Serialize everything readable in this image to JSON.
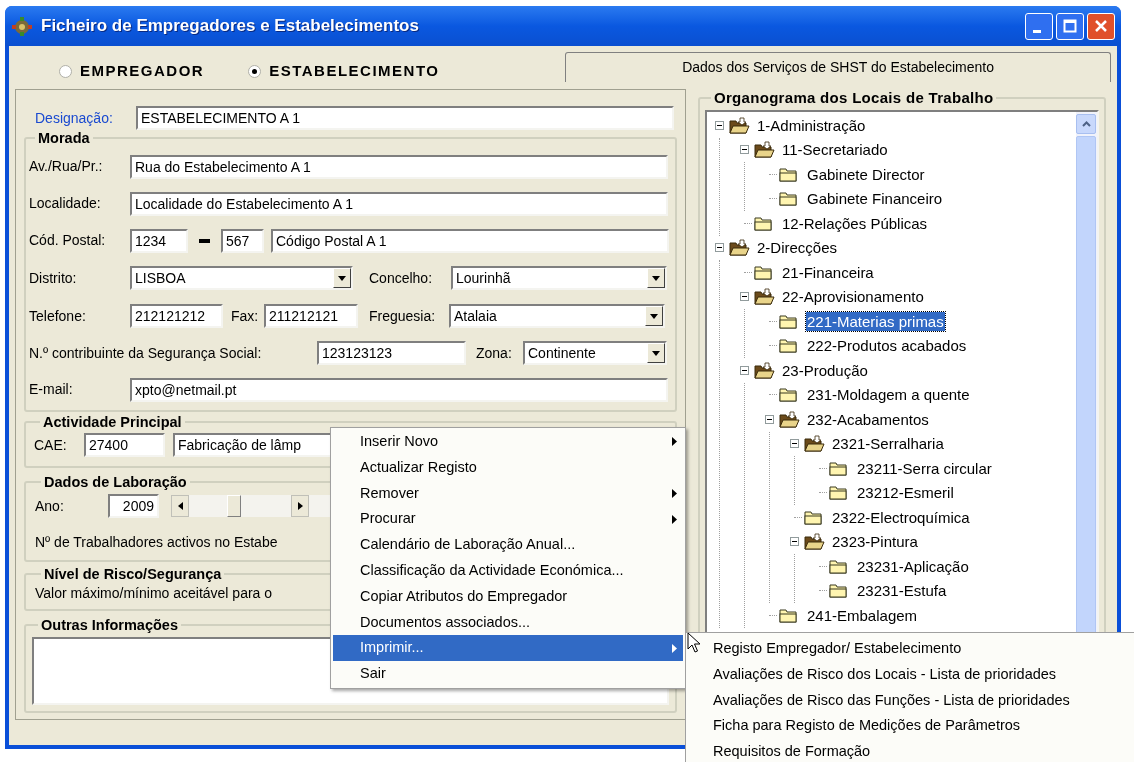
{
  "window": {
    "title": "Ficheiro de Empregadores e Estabelecimentos"
  },
  "entity_type": [
    {
      "label": "EMPREGADOR",
      "selected": false
    },
    {
      "label": "ESTABELECIMENTO",
      "selected": true
    }
  ],
  "tab": {
    "label": "Dados dos Serviços de SHST do Estabelecimento"
  },
  "designation": {
    "label": "Designação:",
    "value": "ESTABELECIMENTO A 1"
  },
  "address": {
    "title": "Morada",
    "street": {
      "label": "Av./Rua/Pr.:",
      "value": "Rua do Estabelecimento A 1"
    },
    "locality": {
      "label": "Localidade:",
      "value": "Localidade do Estabelecimento A 1"
    },
    "postal_code": {
      "label": "Cód. Postal:",
      "part_1": "1234",
      "part_2": "567",
      "description": "Código Postal A 1"
    },
    "district": {
      "label": "Distrito:",
      "value": "LISBOA"
    },
    "municipality": {
      "label": "Concelho:",
      "value": "Lourinhã"
    },
    "phone": {
      "label": "Telefone:",
      "value": "212121212"
    },
    "fax": {
      "label": "Fax:",
      "value": "211212121"
    },
    "parish": {
      "label": "Freguesia:",
      "value": "Atalaia"
    },
    "social_security": {
      "label": "N.º contribuinte da Segurança Social:",
      "value": "123123123"
    },
    "zone": {
      "label": "Zona:",
      "value": "Continente"
    },
    "email": {
      "label": "E-mail:",
      "value": "xpto@netmail.pt"
    }
  },
  "main_activity": {
    "title": "Actividade Principal",
    "cae_label": "CAE:",
    "cae_code": "27400",
    "cae_description": "Fabricação de lâmp"
  },
  "labour_data": {
    "title": "Dados de Laboração",
    "year_label": "Ano:",
    "year": "2009",
    "workers_text": "Nº de Trabalhadores activos no Estabe"
  },
  "risk_level": {
    "title": "Nível de Risco/Segurança",
    "text": "Valor máximo/mínimo aceitável para o"
  },
  "other_info": {
    "title": "Outras Informações"
  },
  "org_chart": {
    "title": "Organograma dos Locais de Trabalho",
    "tree": [
      {
        "label": "1-Administração",
        "expanded": true,
        "selected": false,
        "children": [
          {
            "label": "11-Secretariado",
            "expanded": true,
            "selected": false,
            "children": [
              {
                "label": "Gabinete Director",
                "expanded": false,
                "selected": false
              },
              {
                "label": "Gabinete Financeiro",
                "expanded": false,
                "selected": false
              }
            ]
          },
          {
            "label": "12-Relações Públicas",
            "expanded": false,
            "selected": false
          }
        ]
      },
      {
        "label": "2-Direcções",
        "expanded": true,
        "selected": false,
        "children": [
          {
            "label": "21-Financeira",
            "expanded": false,
            "selected": false
          },
          {
            "label": "22-Aprovisionamento",
            "expanded": true,
            "selected": false,
            "children": [
              {
                "label": "221-Materias primas",
                "expanded": false,
                "selected": true
              },
              {
                "label": "222-Produtos acabados",
                "expanded": false,
                "selected": false
              }
            ]
          },
          {
            "label": "23-Produção",
            "expanded": true,
            "selected": false,
            "children": [
              {
                "label": "231-Moldagem a quente",
                "expanded": false,
                "selected": false
              },
              {
                "label": "232-Acabamentos",
                "expanded": true,
                "selected": false,
                "children": [
                  {
                    "label": "2321-Serralharia",
                    "expanded": true,
                    "selected": false,
                    "children": [
                      {
                        "label": "23211-Serra circular",
                        "expanded": false,
                        "selected": false
                      },
                      {
                        "label": "23212-Esmeril",
                        "expanded": false,
                        "selected": false
                      }
                    ]
                  },
                  {
                    "label": "2322-Electroquímica",
                    "expanded": false,
                    "selected": false
                  },
                  {
                    "label": "2323-Pintura",
                    "expanded": true,
                    "selected": false,
                    "children": [
                      {
                        "label": "23231-Aplicação",
                        "expanded": false,
                        "selected": false
                      },
                      {
                        "label": "23231-Estufa",
                        "expanded": false,
                        "selected": false
                      }
                    ]
                  }
                ]
              },
              {
                "label": "241-Embalagem",
                "expanded": false,
                "selected": false
              }
            ]
          }
        ]
      }
    ]
  },
  "context_menu": {
    "items": [
      {
        "label": "Inserir Novo",
        "has_submenu": true,
        "selected": false
      },
      {
        "label": "Actualizar Registo",
        "has_submenu": false,
        "selected": false
      },
      {
        "label": "Remover",
        "has_submenu": true,
        "selected": false
      },
      {
        "label": "Procurar",
        "has_submenu": true,
        "selected": false
      },
      {
        "label": "Calendário de Laboração Anual...",
        "has_submenu": false,
        "selected": false
      },
      {
        "label": "Classificação da Actividade Económica...",
        "has_submenu": false,
        "selected": false
      },
      {
        "label": "Copiar Atributos do Empregador",
        "has_submenu": false,
        "selected": false
      },
      {
        "label": "Documentos associados...",
        "has_submenu": false,
        "selected": false
      },
      {
        "label": "Imprimir...",
        "has_submenu": true,
        "selected": true
      },
      {
        "label": "Sair",
        "has_submenu": false,
        "selected": false
      }
    ]
  },
  "submenu": {
    "items": [
      {
        "label": "Registo Empregador/ Estabelecimento"
      },
      {
        "label": "Avaliações de Risco dos Locais - Lista de prioridades"
      },
      {
        "label": "Avaliações de Risco das Funções - Lista de prioridades"
      },
      {
        "label": "Ficha para Registo de Medições de Parâmetros"
      },
      {
        "label": "Requisitos de Formação"
      }
    ]
  }
}
